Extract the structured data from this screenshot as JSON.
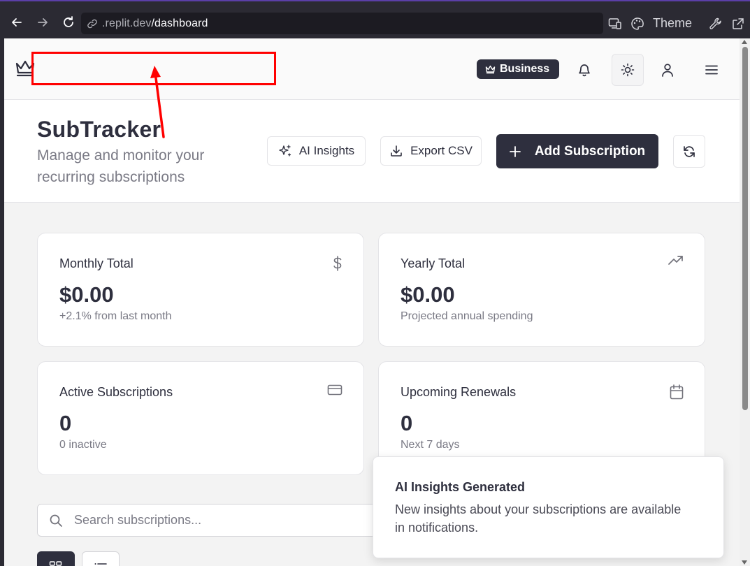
{
  "browser": {
    "url_prefix": ".replit.dev",
    "url_path": "/dashboard",
    "theme_label": "Theme"
  },
  "header": {
    "badge_label": "Business"
  },
  "page": {
    "title": "SubTracker",
    "subtitle": "Manage and monitor your recurring subscriptions",
    "ai_insights_label": "AI Insights",
    "export_label": "Export CSV",
    "add_label": "Add Subscription"
  },
  "stats": [
    {
      "label": "Monthly Total",
      "value": "$0.00",
      "sub": "+2.1% from last month",
      "icon": "dollar-icon"
    },
    {
      "label": "Yearly Total",
      "value": "$0.00",
      "sub": "Projected annual spending",
      "icon": "trending-up-icon"
    },
    {
      "label": "Active Subscriptions",
      "value": "0",
      "sub": "0 inactive",
      "icon": "credit-card-icon"
    },
    {
      "label": "Upcoming Renewals",
      "value": "0",
      "sub": "Next 7 days",
      "icon": "calendar-icon"
    }
  ],
  "search": {
    "placeholder": "Search subscriptions..."
  },
  "toast": {
    "title": "AI Insights Generated",
    "body": "New insights about your subscriptions are available in notifications."
  },
  "colors": {
    "primary": "#2e2f3e",
    "annotation": "#ff0000",
    "browser_chrome": "#2b2a33"
  }
}
